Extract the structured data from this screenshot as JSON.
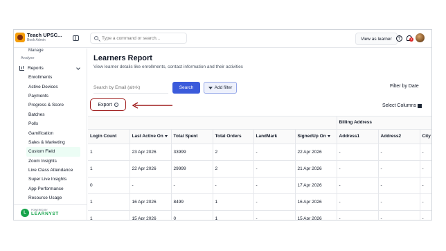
{
  "topbar": {
    "brand_title": "Teach UPSC...",
    "brand_subtitle": "Book Admin",
    "search_placeholder": "Type a command or search...",
    "view_as_learner": "View as learner",
    "help_label": "?",
    "notification_count": "1"
  },
  "sidebar": {
    "cut_item": "Manage",
    "section": "Analyse",
    "reports_label": "Reports",
    "items": [
      {
        "label": "Enrollments"
      },
      {
        "label": "Active Devices"
      },
      {
        "label": "Payments"
      },
      {
        "label": "Progress & Score"
      },
      {
        "label": "Batches"
      },
      {
        "label": "Polls"
      },
      {
        "label": "Gamification"
      },
      {
        "label": "Sales & Marketing"
      },
      {
        "label": "Custom Field",
        "active": true
      },
      {
        "label": "Zoom Insights"
      },
      {
        "label": "Live Class Attendance"
      },
      {
        "label": "Super Live Insights"
      },
      {
        "label": "App Performance"
      },
      {
        "label": "Resource Usage"
      }
    ],
    "footer": {
      "powered_by": "POWERED BY",
      "logo_letter": "L",
      "name": "LEARNYST"
    }
  },
  "main": {
    "title": "Learners Report",
    "subtitle": "View learner details like enrollments, contact information and their activities",
    "email_placeholder": "Search by Email (alt+k)",
    "search_button": "Search",
    "add_filter_button": "Add filter",
    "filter_by_date": "Filter by Date",
    "export_button": "Export",
    "select_columns": "Select Columns",
    "accent_color": "#3b5bdb",
    "highlight_color": "#9f1d1d"
  },
  "table": {
    "group_header": "Billing Address",
    "columns": [
      "Login Count",
      "Last Active On",
      "Total Spent",
      "Total Orders",
      "LandMark",
      "SignedUp On",
      "Address1",
      "Address2",
      "City"
    ],
    "rows": [
      [
        "1",
        "23 Apr 2026",
        "33999",
        "2",
        "-",
        "22 Apr 2026",
        "-",
        "-",
        "-"
      ],
      [
        "1",
        "22 Apr 2026",
        "29999",
        "2",
        "-",
        "21 Apr 2026",
        "-",
        "-",
        "-"
      ],
      [
        "0",
        "-",
        "-",
        "-",
        "-",
        "17 Apr 2026",
        "-",
        "-",
        "-"
      ],
      [
        "1",
        "16 Apr 2026",
        "8499",
        "1",
        "-",
        "16 Apr 2026",
        "-",
        "-",
        "-"
      ],
      [
        "1",
        "15 Apr 2026",
        "0",
        "1",
        "-",
        "15 Apr 2026",
        "-",
        "-",
        "-"
      ]
    ]
  }
}
